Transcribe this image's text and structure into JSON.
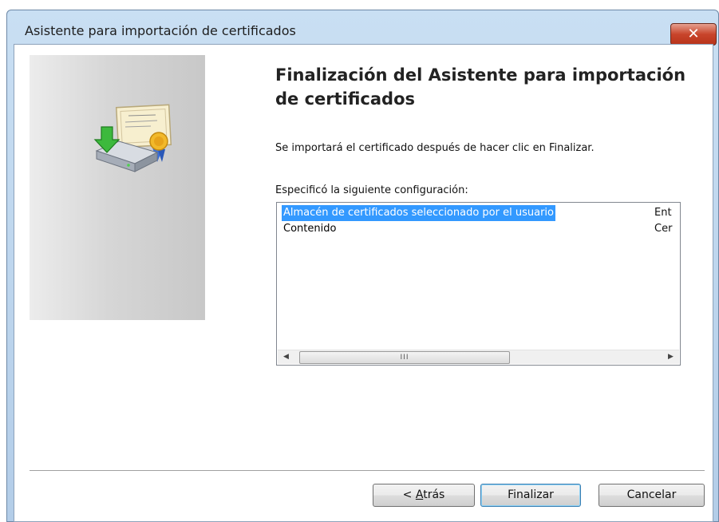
{
  "window": {
    "title": "Asistente para importación de certificados",
    "close_glyph": "✕"
  },
  "icon": "certificate-import-icon",
  "heading": "Finalización del Asistente para importación de certificados",
  "description": "Se importará el certificado después de hacer clic en Finalizar.",
  "spec_label": "Especificó la siguiente configuración:",
  "settings": [
    {
      "name": "Almacén de certificados seleccionado por el usuario",
      "value": "Ent",
      "selected": true
    },
    {
      "name": "Contenido",
      "value": "Cer",
      "selected": false
    }
  ],
  "scrollbar": {
    "left_arrow": "◀",
    "right_arrow": "▶",
    "thumb_grip": "III"
  },
  "buttons": {
    "back_prefix": "< ",
    "back_accel": "A",
    "back_rest": "trás",
    "finish": "Finalizar",
    "cancel": "Cancelar"
  },
  "colors": {
    "selection": "#3399ff",
    "close": "#c8442b",
    "titlebar": "#c9dff3"
  }
}
